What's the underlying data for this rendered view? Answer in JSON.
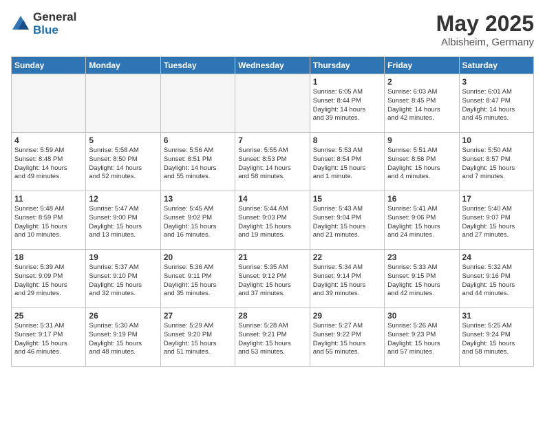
{
  "header": {
    "logo_general": "General",
    "logo_blue": "Blue",
    "month": "May 2025",
    "location": "Albisheim, Germany"
  },
  "weekdays": [
    "Sunday",
    "Monday",
    "Tuesday",
    "Wednesday",
    "Thursday",
    "Friday",
    "Saturday"
  ],
  "weeks": [
    [
      {
        "day": "",
        "info": ""
      },
      {
        "day": "",
        "info": ""
      },
      {
        "day": "",
        "info": ""
      },
      {
        "day": "",
        "info": ""
      },
      {
        "day": "1",
        "info": "Sunrise: 6:05 AM\nSunset: 8:44 PM\nDaylight: 14 hours\nand 39 minutes."
      },
      {
        "day": "2",
        "info": "Sunrise: 6:03 AM\nSunset: 8:45 PM\nDaylight: 14 hours\nand 42 minutes."
      },
      {
        "day": "3",
        "info": "Sunrise: 6:01 AM\nSunset: 8:47 PM\nDaylight: 14 hours\nand 45 minutes."
      }
    ],
    [
      {
        "day": "4",
        "info": "Sunrise: 5:59 AM\nSunset: 8:48 PM\nDaylight: 14 hours\nand 49 minutes."
      },
      {
        "day": "5",
        "info": "Sunrise: 5:58 AM\nSunset: 8:50 PM\nDaylight: 14 hours\nand 52 minutes."
      },
      {
        "day": "6",
        "info": "Sunrise: 5:56 AM\nSunset: 8:51 PM\nDaylight: 14 hours\nand 55 minutes."
      },
      {
        "day": "7",
        "info": "Sunrise: 5:55 AM\nSunset: 8:53 PM\nDaylight: 14 hours\nand 58 minutes."
      },
      {
        "day": "8",
        "info": "Sunrise: 5:53 AM\nSunset: 8:54 PM\nDaylight: 15 hours\nand 1 minute."
      },
      {
        "day": "9",
        "info": "Sunrise: 5:51 AM\nSunset: 8:56 PM\nDaylight: 15 hours\nand 4 minutes."
      },
      {
        "day": "10",
        "info": "Sunrise: 5:50 AM\nSunset: 8:57 PM\nDaylight: 15 hours\nand 7 minutes."
      }
    ],
    [
      {
        "day": "11",
        "info": "Sunrise: 5:48 AM\nSunset: 8:59 PM\nDaylight: 15 hours\nand 10 minutes."
      },
      {
        "day": "12",
        "info": "Sunrise: 5:47 AM\nSunset: 9:00 PM\nDaylight: 15 hours\nand 13 minutes."
      },
      {
        "day": "13",
        "info": "Sunrise: 5:45 AM\nSunset: 9:02 PM\nDaylight: 15 hours\nand 16 minutes."
      },
      {
        "day": "14",
        "info": "Sunrise: 5:44 AM\nSunset: 9:03 PM\nDaylight: 15 hours\nand 19 minutes."
      },
      {
        "day": "15",
        "info": "Sunrise: 5:43 AM\nSunset: 9:04 PM\nDaylight: 15 hours\nand 21 minutes."
      },
      {
        "day": "16",
        "info": "Sunrise: 5:41 AM\nSunset: 9:06 PM\nDaylight: 15 hours\nand 24 minutes."
      },
      {
        "day": "17",
        "info": "Sunrise: 5:40 AM\nSunset: 9:07 PM\nDaylight: 15 hours\nand 27 minutes."
      }
    ],
    [
      {
        "day": "18",
        "info": "Sunrise: 5:39 AM\nSunset: 9:09 PM\nDaylight: 15 hours\nand 29 minutes."
      },
      {
        "day": "19",
        "info": "Sunrise: 5:37 AM\nSunset: 9:10 PM\nDaylight: 15 hours\nand 32 minutes."
      },
      {
        "day": "20",
        "info": "Sunrise: 5:36 AM\nSunset: 9:11 PM\nDaylight: 15 hours\nand 35 minutes."
      },
      {
        "day": "21",
        "info": "Sunrise: 5:35 AM\nSunset: 9:12 PM\nDaylight: 15 hours\nand 37 minutes."
      },
      {
        "day": "22",
        "info": "Sunrise: 5:34 AM\nSunset: 9:14 PM\nDaylight: 15 hours\nand 39 minutes."
      },
      {
        "day": "23",
        "info": "Sunrise: 5:33 AM\nSunset: 9:15 PM\nDaylight: 15 hours\nand 42 minutes."
      },
      {
        "day": "24",
        "info": "Sunrise: 5:32 AM\nSunset: 9:16 PM\nDaylight: 15 hours\nand 44 minutes."
      }
    ],
    [
      {
        "day": "25",
        "info": "Sunrise: 5:31 AM\nSunset: 9:17 PM\nDaylight: 15 hours\nand 46 minutes."
      },
      {
        "day": "26",
        "info": "Sunrise: 5:30 AM\nSunset: 9:19 PM\nDaylight: 15 hours\nand 48 minutes."
      },
      {
        "day": "27",
        "info": "Sunrise: 5:29 AM\nSunset: 9:20 PM\nDaylight: 15 hours\nand 51 minutes."
      },
      {
        "day": "28",
        "info": "Sunrise: 5:28 AM\nSunset: 9:21 PM\nDaylight: 15 hours\nand 53 minutes."
      },
      {
        "day": "29",
        "info": "Sunrise: 5:27 AM\nSunset: 9:22 PM\nDaylight: 15 hours\nand 55 minutes."
      },
      {
        "day": "30",
        "info": "Sunrise: 5:26 AM\nSunset: 9:23 PM\nDaylight: 15 hours\nand 57 minutes."
      },
      {
        "day": "31",
        "info": "Sunrise: 5:25 AM\nSunset: 9:24 PM\nDaylight: 15 hours\nand 58 minutes."
      }
    ]
  ]
}
